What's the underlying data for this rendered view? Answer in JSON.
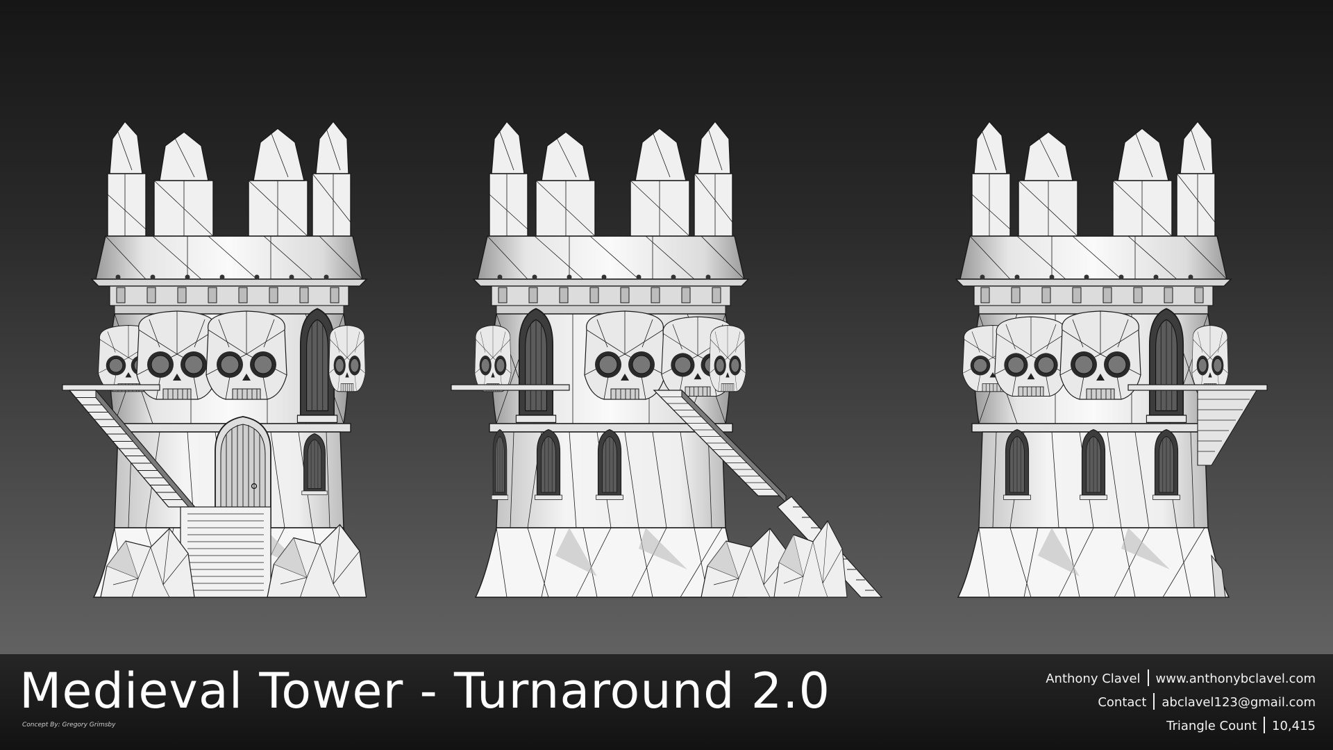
{
  "title": "Medieval Tower - Turnaround 2.0",
  "concept_credit": "Concept By: Gregory Grimsby",
  "info": [
    {
      "label": "Anthony Clavel",
      "value": "www.anthonybclavel.com"
    },
    {
      "label": "Contact",
      "value": "abclavel123@gmail.com"
    },
    {
      "label": "Triangle Count",
      "value": "10,415"
    }
  ],
  "views": [
    {
      "name": "left",
      "stairs": "left"
    },
    {
      "name": "center",
      "stairs": "right"
    },
    {
      "name": "right",
      "stairs": "right-hidden"
    }
  ],
  "colors": {
    "surface": "#f2f2f2",
    "wire": "#1a1a1a",
    "shade": "#b8b8b8"
  }
}
